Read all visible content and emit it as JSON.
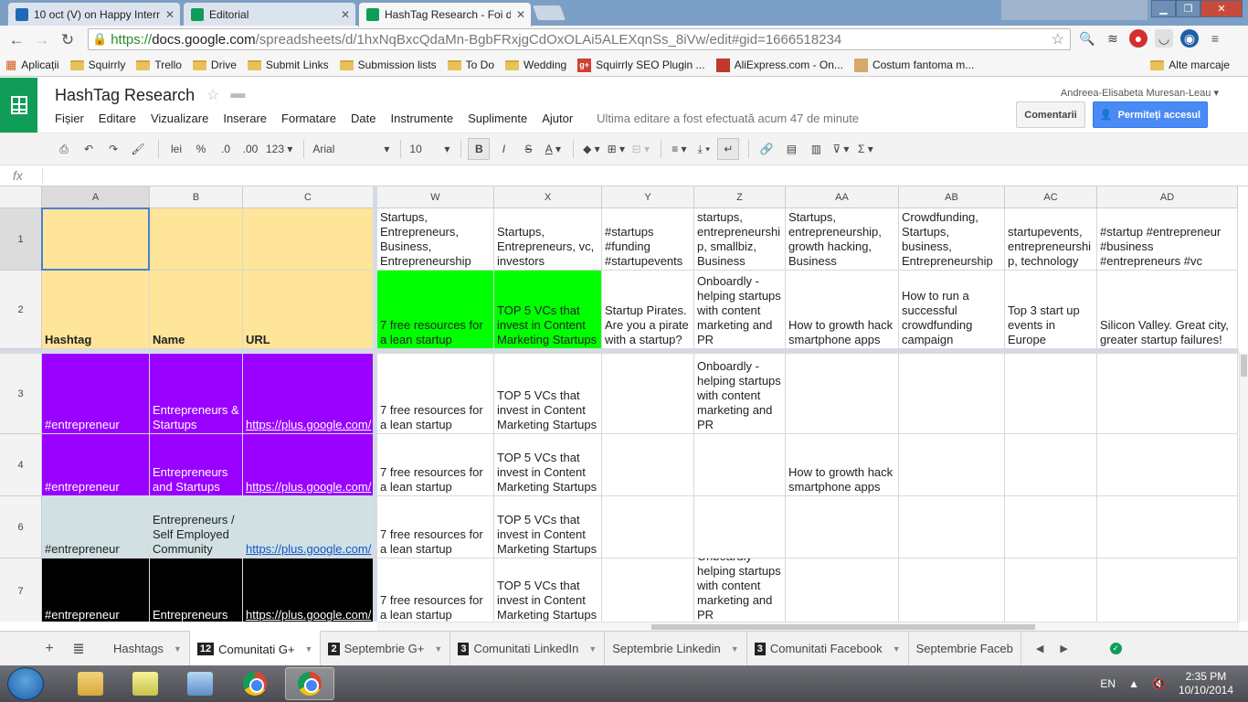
{
  "browser": {
    "tabs": [
      {
        "title": "10 oct (V) on Happy Intern",
        "icon_color": "#1f68b7"
      },
      {
        "title": "Editorial",
        "icon_color": "#0f9d58"
      },
      {
        "title": "HashTag Research - Foi de",
        "icon_color": "#0f9d58"
      }
    ],
    "address": {
      "https": "https://",
      "host": "docs.google.com",
      "path": "/spreadsheets/d/1hxNqBxcQdaMn-BgbFRxjgCdOxOLAi5ALEXqnSs_8iVw/edit#gid=1666518234"
    },
    "bookmarks": [
      {
        "label": "Aplicații",
        "icon": "apps-icon"
      },
      {
        "label": "Squirrly",
        "icon": "folder-icon"
      },
      {
        "label": "Trello",
        "icon": "folder-icon"
      },
      {
        "label": "Drive",
        "icon": "folder-icon"
      },
      {
        "label": "Submit Links",
        "icon": "folder-icon"
      },
      {
        "label": "Submission lists",
        "icon": "folder-icon"
      },
      {
        "label": "To Do",
        "icon": "folder-icon"
      },
      {
        "label": "Wedding",
        "icon": "folder-icon"
      },
      {
        "label": "Squirrly SEO Plugin ...",
        "icon": "google-plus-icon"
      },
      {
        "label": "AliExpress.com - On...",
        "icon": "aliexpress-icon"
      },
      {
        "label": "Costum fantoma m...",
        "icon": "costume-icon"
      }
    ],
    "other_bookmarks": "Alte marcaje"
  },
  "doc": {
    "title": "HashTag Research",
    "user": "Andreea-Elisabeta Muresan-Leau",
    "menu": [
      "Fișier",
      "Editare",
      "Vizualizare",
      "Inserare",
      "Formatare",
      "Date",
      "Instrumente",
      "Suplimente",
      "Ajutor"
    ],
    "last_edit": "Ultima editare a fost efectuată acum 47 de minute",
    "comments_btn": "Comentarii",
    "share_btn": "Permiteți accesul"
  },
  "format_toolbar": {
    "currency_label": "lei",
    "percent": "%",
    "dec_less": ".0",
    "dec_more": ".00",
    "number_fmt": "123",
    "font": "Arial",
    "size": "10"
  },
  "formula_bar": {
    "fx": "fx",
    "value": ""
  },
  "grid": {
    "columns": [
      "A",
      "B",
      "C",
      "W",
      "X",
      "Y",
      "Z",
      "AA",
      "AB",
      "AC",
      "AD"
    ],
    "rows": [
      "1",
      "2",
      "3",
      "4",
      "6",
      "7"
    ],
    "row_colors": [
      "#ffe599",
      "#ffe599",
      "#9900ff",
      "#9900ff",
      "#d0e0e3",
      "#000000"
    ],
    "green": "#00ff00",
    "cells": {
      "r1": [
        "",
        "",
        "",
        "Startups, Entrepreneurs, Business, Entrepreneurship",
        "Startups, Entrepreneurs, vc, investors",
        "#startups #funding #startupevents",
        "startups, entrepreneurship, smallbiz, Business",
        "Startups, entrepreneurship, growth hacking, Business",
        "Crowdfunding, Startups, business, Entrepreneurship",
        "startupevents, entrepreneurship, technology",
        "#startup #entrepreneur #business #entrepreneurs #vc"
      ],
      "r2": [
        "Hashtag",
        "Name",
        "URL",
        "7 free resources for a lean startup",
        "TOP 5 VCs that invest in Content Marketing Startups",
        "Startup Pirates. Are you a pirate with a startup?",
        "Onboardly - helping startups with content marketing and PR",
        "How to growth hack smartphone apps",
        "How to run a successful crowdfunding campaign",
        "Top 3 start up events in Europe",
        "Silicon Valley. Great city, greater startup failures!"
      ],
      "r3": [
        "#entrepreneur",
        "Entrepreneurs & Startups",
        "https://plus.google.com/",
        "7 free resources for a lean startup",
        "TOP 5 VCs that invest in Content Marketing Startups",
        "",
        "Onboardly - helping startups with content marketing and PR",
        "",
        "",
        "",
        ""
      ],
      "r4": [
        "#entrepreneur",
        "Entrepreneurs and Startups",
        "https://plus.google.com/",
        "7 free resources for a lean startup",
        "TOP 5 VCs that invest in Content Marketing Startups",
        "",
        "",
        "How to growth hack smartphone apps",
        "",
        "",
        ""
      ],
      "r6": [
        "#entrepreneur",
        "Entrepreneurs / Self Employed Community",
        "https://plus.google.com/",
        "7 free resources for a lean startup",
        "TOP 5 VCs that invest in Content Marketing Startups",
        "",
        "",
        "",
        "",
        "",
        ""
      ],
      "r7": [
        "#entrepreneur",
        "Entrepreneurs",
        "https://plus.google.com/",
        "7 free resources for a lean startup",
        "TOP 5 VCs that invest in Content Marketing Startups",
        "",
        "Onboardly - helping startups with content marketing and PR",
        "",
        "",
        "",
        ""
      ]
    }
  },
  "sheets": [
    {
      "name": "Hashtags",
      "count": ""
    },
    {
      "name": "Comunitati G+",
      "count": "12"
    },
    {
      "name": "Septembrie G+",
      "count": "2"
    },
    {
      "name": "Comunitati LinkedIn",
      "count": "3"
    },
    {
      "name": "Septembrie Linkedin",
      "count": ""
    },
    {
      "name": "Comunitati Facebook",
      "count": "3"
    },
    {
      "name": "Septembrie Faceb",
      "count": ""
    }
  ],
  "taskbar": {
    "lang": "EN",
    "time": "2:35 PM",
    "date": "10/10/2014"
  }
}
